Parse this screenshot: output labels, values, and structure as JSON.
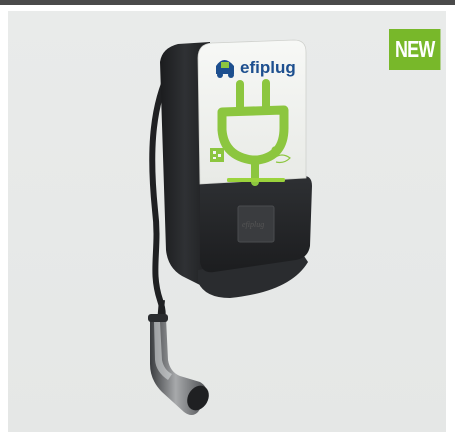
{
  "badge": {
    "label": "NEW",
    "color": "#78b82a"
  },
  "product": {
    "brand": "efiplug",
    "plate_text": "efiplug",
    "colors": {
      "body": "#2b2d30",
      "face": "#f4f5f3",
      "accent": "#8cc63f",
      "brand_blue": "#1d4f8f"
    }
  }
}
